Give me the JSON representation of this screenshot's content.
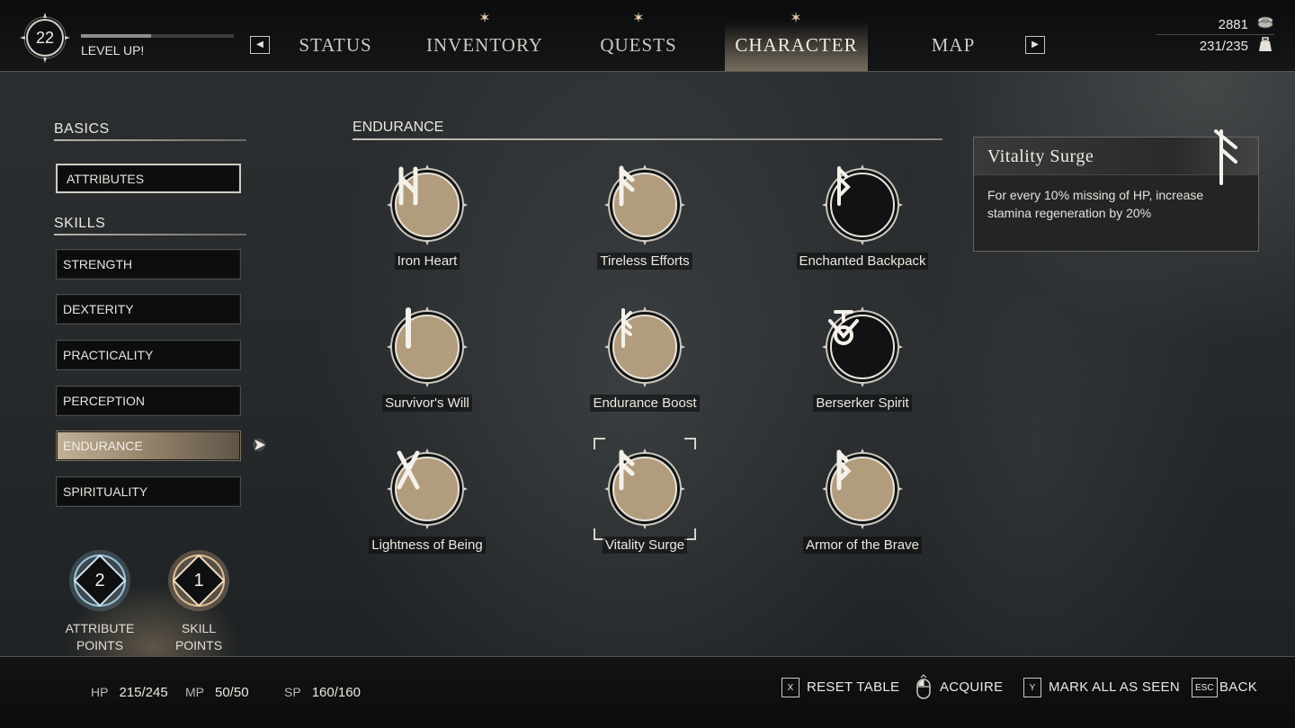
{
  "header": {
    "level": "22",
    "level_up": "LEVEL UP!",
    "xp_progress": 0.46,
    "tabs": [
      {
        "label": "STATUS",
        "new": false,
        "active": false
      },
      {
        "label": "INVENTORY",
        "new": true,
        "active": false
      },
      {
        "label": "QUESTS",
        "new": true,
        "active": false
      },
      {
        "label": "CHARACTER",
        "new": true,
        "active": true
      },
      {
        "label": "MAP",
        "new": false,
        "active": false
      }
    ],
    "new_marker": "✶",
    "prev_icon": "◀",
    "next_icon": "▶",
    "gold": "2881",
    "weight": "231/235"
  },
  "sidebar": {
    "basics_title": "BASICS",
    "attributes_label": "ATTRIBUTES",
    "skills_title": "SKILLS",
    "skills": [
      {
        "label": "STRENGTH",
        "active": false
      },
      {
        "label": "DEXTERITY",
        "active": false
      },
      {
        "label": "PRACTICALITY",
        "active": false
      },
      {
        "label": "PERCEPTION",
        "active": false
      },
      {
        "label": "ENDURANCE",
        "active": true
      },
      {
        "label": "SPIRITUALITY",
        "active": false
      }
    ],
    "attribute_points": {
      "value": "2",
      "label_line1": "ATTRIBUTE",
      "label_line2": "POINTS"
    },
    "skill_points": {
      "value": "1",
      "label_line1": "SKILL",
      "label_line2": "POINTS"
    }
  },
  "skill_tree": {
    "title": "ENDURANCE",
    "skills": [
      {
        "name": "Iron Heart",
        "unlocked": true,
        "selected": false
      },
      {
        "name": "Tireless Efforts",
        "unlocked": true,
        "selected": false
      },
      {
        "name": "Enchanted Backpack",
        "unlocked": false,
        "selected": false
      },
      {
        "name": "Survivor's Will",
        "unlocked": true,
        "selected": false
      },
      {
        "name": "Endurance Boost",
        "unlocked": true,
        "selected": false
      },
      {
        "name": "Berserker Spirit",
        "unlocked": false,
        "selected": false
      },
      {
        "name": "Lightness of Being",
        "unlocked": true,
        "selected": false
      },
      {
        "name": "Vitality Surge",
        "unlocked": true,
        "selected": true
      },
      {
        "name": "Armor of the Brave",
        "unlocked": true,
        "selected": false
      }
    ]
  },
  "tooltip": {
    "title": "Vitality Surge",
    "description": "For every 10% missing of HP, increase stamina regeneration by 20%"
  },
  "footer": {
    "hp_label": "HP",
    "hp_value": "215/245",
    "mp_label": "MP",
    "mp_value": "50/50",
    "sp_label": "SP",
    "sp_value": "160/160",
    "actions": [
      {
        "key": "X",
        "label": "RESET TABLE"
      },
      {
        "key": "mouse",
        "label": "ACQUIRE"
      },
      {
        "key": "Y",
        "label": "MARK ALL AS SEEN"
      },
      {
        "key": "ESC",
        "label": "BACK"
      }
    ]
  },
  "colors": {
    "unlocked_fill": "#b29c7e",
    "locked_fill": "#111213",
    "active_menu": "#c2b197",
    "attribute_points_glow": "#8fb8d0",
    "skill_points_glow": "#d8b48a"
  }
}
